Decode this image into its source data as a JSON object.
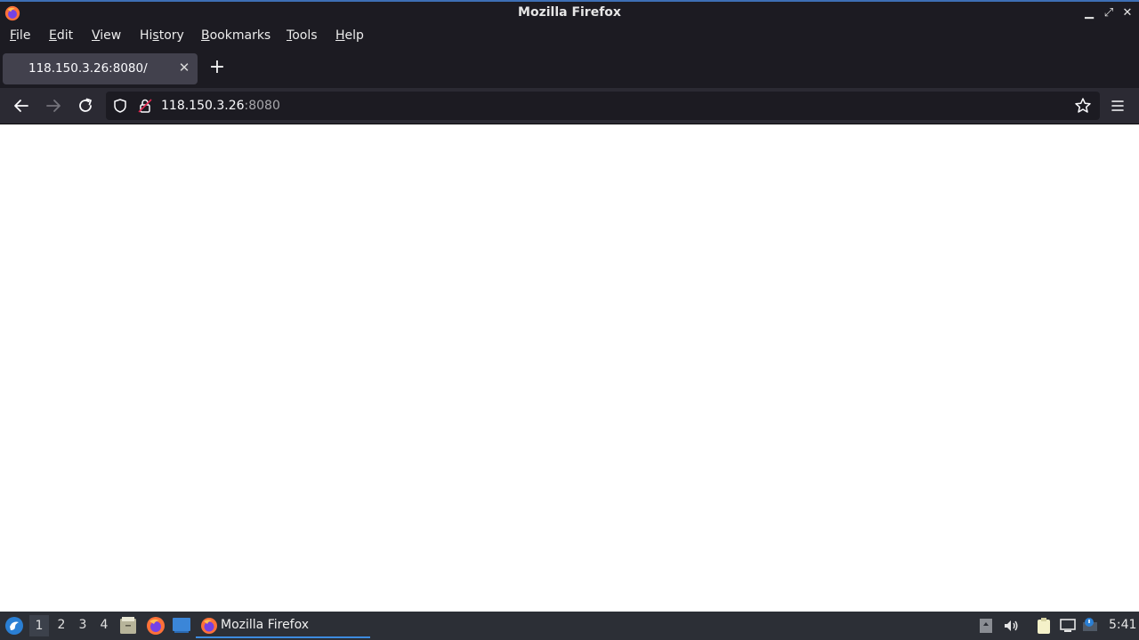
{
  "window": {
    "title": "Mozilla Firefox",
    "minimize_glyph": "▁",
    "maximize_glyph": "⤢",
    "close_glyph": "✕"
  },
  "menubar": {
    "items": [
      {
        "first": "F",
        "rest": "ile"
      },
      {
        "first": "E",
        "rest": "dit"
      },
      {
        "first": "V",
        "rest": "iew"
      },
      {
        "pre": "Hi",
        "first": "s",
        "rest": "tory"
      },
      {
        "first": "B",
        "rest": "ookmarks"
      },
      {
        "first": "T",
        "rest": "ools"
      },
      {
        "first": "H",
        "rest": "elp"
      }
    ]
  },
  "tabs": {
    "active_title": "118.150.3.26:8080/",
    "close_glyph": "✕",
    "new_tab_glyph": "+"
  },
  "navbar": {
    "url_host": "118.150.3.26",
    "url_port": ":8080"
  },
  "taskbar": {
    "workspaces": [
      "1",
      "2",
      "3",
      "4"
    ],
    "active_workspace": "1",
    "task_label": "Mozilla Firefox",
    "clock": "5:41"
  },
  "colors": {
    "titlebar_bg": "#1c1b22",
    "navbar_bg": "#2b2a33",
    "tab_active_bg": "#42414d",
    "taskbar_bg": "#2c2f36",
    "accent": "#3d8be0"
  },
  "icons": {
    "app": "firefox-icon",
    "back": "back-arrow-icon",
    "forward": "forward-arrow-icon",
    "reload": "reload-icon",
    "tracking": "shield-icon",
    "security": "lock-icon",
    "bookmark": "star-icon",
    "menu": "hamburger-menu-icon"
  }
}
